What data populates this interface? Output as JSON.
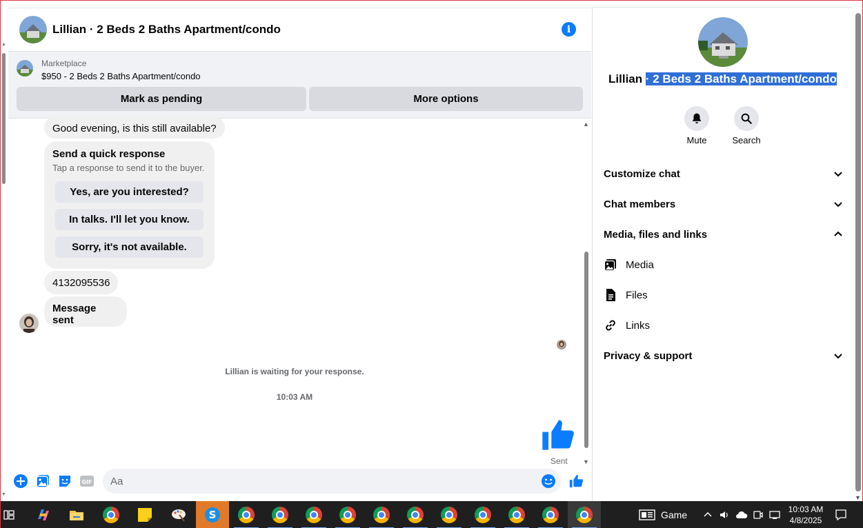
{
  "chat": {
    "header_title": "Lillian · 2 Beds 2 Baths Apartment/condo",
    "marketplace_label": "Marketplace",
    "listing": "$950 - 2 Beds 2 Baths Apartment/condo",
    "mark_pending": "Mark as pending",
    "more_options": "More options",
    "messages": {
      "first": "Good evening, is this still available?",
      "quick_title": "Send a quick response",
      "quick_sub": "Tap a response to send it to the buyer.",
      "options": [
        "Yes, are you interested?",
        "In talks. I'll let you know.",
        "Sorry, it's not available."
      ],
      "phone": "4132095536",
      "sent_msg": "Message sent",
      "waiting": "Lillian is waiting for your response.",
      "time": "10:03 AM",
      "sent_status": "Sent"
    },
    "composer_placeholder": "Aa"
  },
  "info_panel": {
    "name_plain": "Lillian ",
    "name_selected": "· 2 Beds 2 Baths Apartment/condo",
    "mute": "Mute",
    "search": "Search",
    "sections": [
      "Customize chat",
      "Chat members",
      "Media, files and links",
      "Privacy & support"
    ],
    "media_items": [
      "Media",
      "Files",
      "Links"
    ]
  },
  "taskbar": {
    "game": "Game",
    "time": "10:03 AM",
    "date": "4/8/2025"
  },
  "colors": {
    "accent": "#0a7cff",
    "selection": "#2f6fd6",
    "bubble": "#f0f0f0",
    "taskbar": "#1f1f1f"
  }
}
